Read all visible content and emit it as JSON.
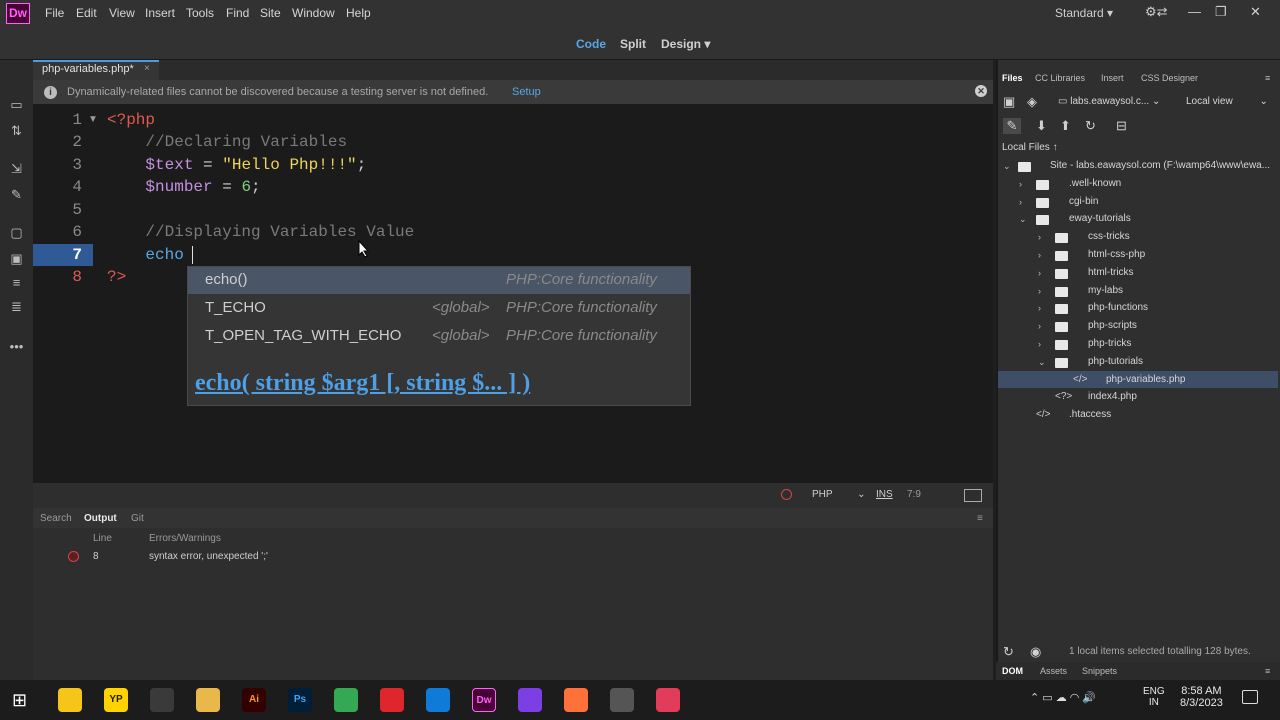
{
  "app": {
    "logo": "Dw"
  },
  "menu": [
    "File",
    "Edit",
    "View",
    "Insert",
    "Tools",
    "Find",
    "Site",
    "Window",
    "Help"
  ],
  "workspace": {
    "label": "Standard ▾"
  },
  "view_buttons": {
    "code": "Code",
    "split": "Split",
    "design": "Design ▾"
  },
  "doc_tab": {
    "label": "php-variables.php*",
    "close": "×"
  },
  "info_bar": {
    "text": "Dynamically-related files cannot be discovered because a testing server is not defined.",
    "link": "Setup"
  },
  "editor": {
    "line_numbers": [
      "1",
      "2",
      "3",
      "4",
      "5",
      "6",
      "7",
      "8"
    ],
    "lines": [
      {
        "parts": [
          {
            "t": "<?php",
            "c": "#e05a4f"
          }
        ]
      },
      {
        "parts": [
          {
            "t": "    //Declaring Variables",
            "c": "#7a7a7a"
          }
        ]
      },
      {
        "parts": [
          {
            "t": "    $text",
            "c": "#c48fe0"
          },
          {
            "t": " = ",
            "c": "#d0d0d0"
          },
          {
            "t": "\"Hello Php!!!\"",
            "c": "#f0d35c"
          },
          {
            "t": ";",
            "c": "#d0d0d0"
          }
        ]
      },
      {
        "parts": [
          {
            "t": "    $number",
            "c": "#c48fe0"
          },
          {
            "t": " = ",
            "c": "#d0d0d0"
          },
          {
            "t": "6",
            "c": "#7fd07f"
          },
          {
            "t": ";",
            "c": "#d0d0d0"
          }
        ]
      },
      {
        "parts": []
      },
      {
        "parts": [
          {
            "t": "    //Displaying Variables Value",
            "c": "#7a7a7a"
          }
        ]
      },
      {
        "parts": [
          {
            "t": "    echo",
            "c": "#5aa6e6"
          }
        ]
      },
      {
        "parts": [
          {
            "t": "?>",
            "c": "#e05a4f"
          }
        ]
      }
    ]
  },
  "autocomplete": {
    "items": [
      {
        "name": "echo()",
        "scope": "",
        "type": "PHP:Core functionality"
      },
      {
        "name": "T_ECHO",
        "scope": "<global>",
        "type": "PHP:Core functionality"
      },
      {
        "name": "T_OPEN_TAG_WITH_ECHO",
        "scope": "<global>",
        "type": "PHP:Core functionality"
      }
    ],
    "signature": "echo( string $arg1 [, string $... ] )"
  },
  "status_bar": {
    "language": "PHP",
    "mode": "INS",
    "position": "7:9"
  },
  "output_panel": {
    "tabs": [
      "Search",
      "Output",
      "Git"
    ],
    "headers": {
      "line": "Line",
      "errors": "Errors/Warnings"
    },
    "rows": [
      {
        "line": "8",
        "message": "syntax error, unexpected ';'"
      }
    ]
  },
  "right_panel": {
    "tabs": [
      "Files",
      "CC Libraries",
      "Insert",
      "CSS Designer"
    ],
    "site_select": "labs.eawaysol.c...",
    "view_select": "Local view",
    "local_files_label": "Local Files ↑",
    "tree": [
      {
        "label": "Site - labs.eawaysol.com (F:\\wamp64\\www\\ewa...",
        "level": 0,
        "kind": "folder",
        "chev": "⌄"
      },
      {
        "label": ".well-known",
        "level": 1,
        "kind": "folder",
        "chev": "›"
      },
      {
        "label": "cgi-bin",
        "level": 1,
        "kind": "folder",
        "chev": "›"
      },
      {
        "label": "eway-tutorials",
        "level": 1,
        "kind": "folder",
        "chev": "⌄"
      },
      {
        "label": "css-tricks",
        "level": 2,
        "kind": "folder",
        "chev": "›"
      },
      {
        "label": "html-css-php",
        "level": 2,
        "kind": "folder",
        "chev": "›"
      },
      {
        "label": "html-tricks",
        "level": 2,
        "kind": "folder",
        "chev": "›"
      },
      {
        "label": "my-labs",
        "level": 2,
        "kind": "folder",
        "chev": "›"
      },
      {
        "label": "php-functions",
        "level": 2,
        "kind": "folder",
        "chev": "›"
      },
      {
        "label": "php-scripts",
        "level": 2,
        "kind": "folder",
        "chev": "›"
      },
      {
        "label": "php-tricks",
        "level": 2,
        "kind": "folder",
        "chev": "›"
      },
      {
        "label": "php-tutorials",
        "level": 2,
        "kind": "folder",
        "chev": "⌄"
      },
      {
        "label": "php-variables.php",
        "level": 3,
        "kind": "code",
        "chev": ""
      },
      {
        "label": "index4.php",
        "level": 2,
        "kind": "php",
        "chev": ""
      },
      {
        "label": ".htaccess",
        "level": 1,
        "kind": "code",
        "chev": ""
      }
    ],
    "status": "1 local items selected totalling 128 bytes.",
    "bottom_tabs": [
      "DOM",
      "Assets",
      "Snippets"
    ]
  },
  "taskbar": {
    "apps": [
      {
        "label": "",
        "color": "#f5c518"
      },
      {
        "label": "YP",
        "color": "#ffd200"
      },
      {
        "label": "",
        "color": "#3a3a3a"
      },
      {
        "label": "",
        "color": "#e8b84a"
      },
      {
        "label": "Ai",
        "color": "#330000"
      },
      {
        "label": "Ps",
        "color": "#001e36"
      },
      {
        "label": "",
        "color": "#34a853"
      },
      {
        "label": "",
        "color": "#e0262d"
      },
      {
        "label": "",
        "color": "#0f7bd8"
      },
      {
        "label": "Dw",
        "color": "#470137"
      },
      {
        "label": "",
        "color": "#7b3fe4"
      },
      {
        "label": "",
        "color": "#ff7139"
      },
      {
        "label": "",
        "color": "#555"
      },
      {
        "label": "",
        "color": "#e33b5a"
      }
    ],
    "lang": "ENG\nIN",
    "time": "8:58 AM",
    "date": "8/3/2023"
  },
  "colors": {
    "accent": "#4a9be0",
    "selection": "#2f5a96"
  }
}
